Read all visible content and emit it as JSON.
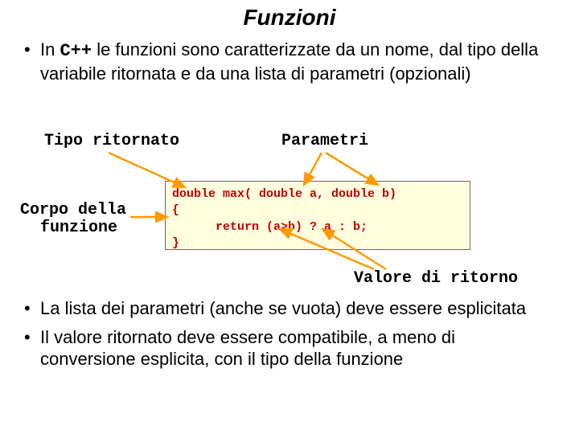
{
  "title": "Funzioni",
  "bullet1_prefix": "In ",
  "bullet1_cpp": "C++",
  "bullet1_rest": " le funzioni sono caratterizzate da un nome, dal tipo della variabile ritornata e da una lista di parametri (opzionali)",
  "labels": {
    "tipo": "Tipo ritornato",
    "parametri": "Parametri",
    "corpo1": "Corpo della",
    "corpo2": "funzione",
    "valore": "Valore di ritorno"
  },
  "code": {
    "l1": "double max( double a, double b)",
    "l2": "{",
    "l3": "      return (a>b) ? a : b;",
    "l4": "}"
  },
  "bullet2": "La lista dei parametri (anche se vuota) deve essere esplicitata",
  "bullet3": "Il valore ritornato deve essere compatibile, a meno di conversione esplicita, con il tipo della funzione"
}
